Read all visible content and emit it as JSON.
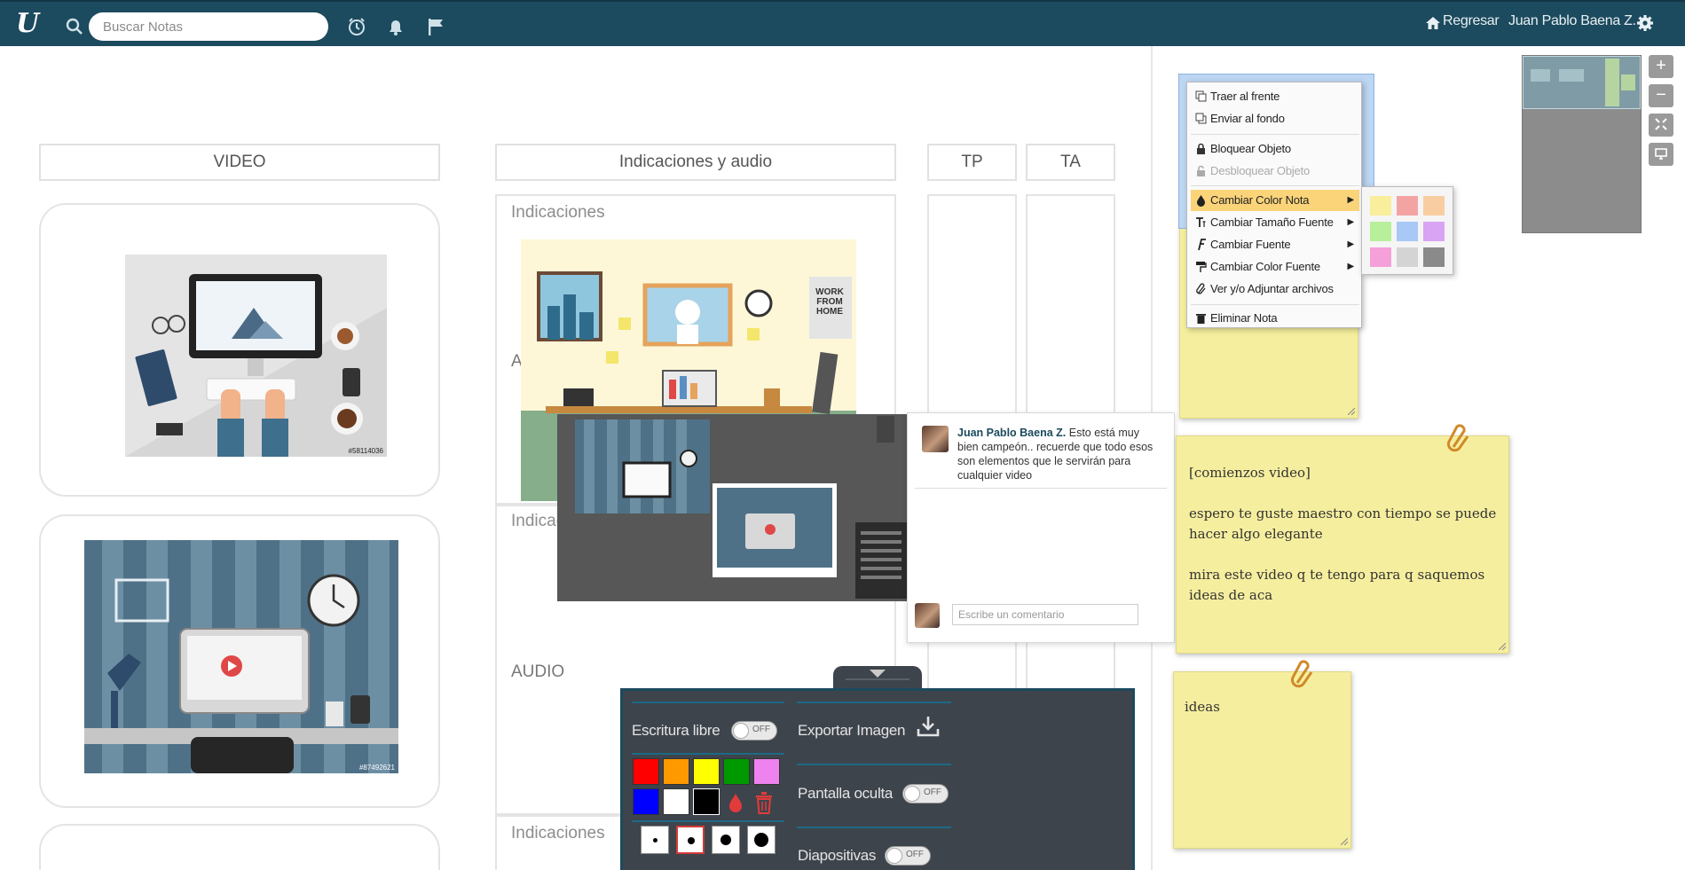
{
  "header": {
    "search_placeholder": "Buscar Notas",
    "back_label": "Regresar",
    "user_name": "Juan Pablo Baena Z."
  },
  "board": {
    "col_video": "VIDEO",
    "col_indicaciones": "Indicaciones y audio",
    "col_tp": "TP",
    "col_ta": "TA",
    "label_indicaciones_1": "Indicaciones",
    "label_indicaciones_2": "Indicac",
    "label_indicaciones_3": "Indicaciones",
    "label_audio_partial": "A",
    "label_audio": "AUDIO",
    "stock_id_1": "#58114036",
    "stock_id_2": "#87492621"
  },
  "comment": {
    "author": "Juan Pablo Baena Z.",
    "text": " Esto está muy bien campeón.. recuerde que todo esos son elementos que le servirán para cualquier video",
    "input_placeholder": "Escribe un comentario"
  },
  "toolbar": {
    "free_writing": "Escritura libre",
    "export_image": "Exportar Imagen",
    "hidden_screen": "Pantalla oculta",
    "slides": "Diapositivas",
    "toggle_off": "OFF",
    "colors": [
      "#ff0000",
      "#ff9900",
      "#ffff00",
      "#009900",
      "#ee82ee",
      "#0000ff",
      "#ffffff",
      "#000000"
    ]
  },
  "context_menu": {
    "bring_front": "Traer al frente",
    "send_back": "Enviar al fondo",
    "lock": "Bloquear Objeto",
    "unlock": "Desbloquear Objeto",
    "note_color": "Cambiar Color Nota",
    "font_size": "Cambiar Tamaño Fuente",
    "font": "Cambiar Fuente",
    "font_color": "Cambiar Color Fuente",
    "attachments": "Ver y/o Adjuntar archivos",
    "delete": "Eliminar Nota",
    "note_colors": [
      "#f8ee9c",
      "#f4a3a3",
      "#f9cda2",
      "#b7ef9a",
      "#a8c8f6",
      "#d9a4f3",
      "#f5a0d8",
      "#d4d4d4",
      "#8a8a8a"
    ]
  },
  "notes": {
    "note1_text": "[comienzos video]\n\nespero te guste maestro con tiempo se puede hacer algo elegante\n\nmira este video q te tengo para q saquemos ideas de aca",
    "note2_text": "ideas"
  },
  "zoom": {
    "plus": "+",
    "minus": "−"
  }
}
